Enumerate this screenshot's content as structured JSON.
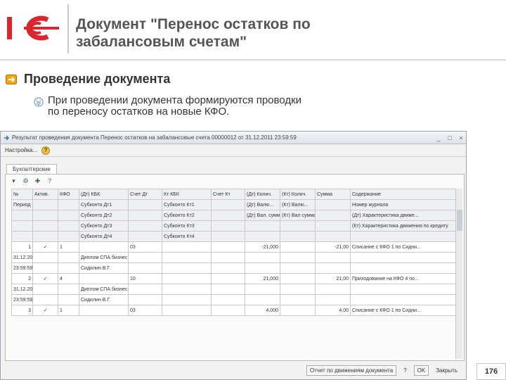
{
  "slide": {
    "title_line1": "Документ \"Перенос остатков по",
    "title_line2": "забалансовым счетам\"",
    "bullet1": "Проведение документа",
    "bullet2_line1": "При проведении документа формируются проводки",
    "bullet2_line2": "по переносу остатков на новые КФО.",
    "page_number": "176",
    "colors": {
      "logo_red": "#d7282f",
      "title_gray": "#555555"
    }
  },
  "window": {
    "title": "Результат проведения документа Перенос остатков на забалансовые счета 00000012 от 31.12.2011 23:59:59",
    "menu_label": "Настройка...",
    "tab_label": "Бухгалтерские",
    "header_rows": [
      [
        "№",
        "Актив.",
        "КФО",
        "(Дт) КБК",
        "Счет Дт",
        "Кт КБК",
        "Счет Кт",
        "(Дт) Колич.",
        "(Кт) Колич.",
        "Сумма",
        "Содержание"
      ],
      [
        "Период",
        "",
        "",
        "Субконто Дт1",
        "",
        "Субконто Кт1",
        "",
        "(Дт) Валю...",
        "(Кт) Валю...",
        "",
        "Номер журнала"
      ],
      [
        "",
        "",
        "",
        "Субконто Дт2",
        "",
        "Субконто Кт2",
        "",
        "(Дт) Вал. сумма",
        "(Кт) Вал сумма",
        "",
        "(Дт) Характеристика движе..."
      ],
      [
        "",
        "",
        "",
        "Субконто Дт3",
        "",
        "Субконто Кт3",
        "",
        "",
        "",
        "",
        "(Кт) Характеристика движения по кредиту"
      ],
      [
        "",
        "",
        "",
        "Субконто Дт4",
        "",
        "Субконто Кт4",
        "",
        "",
        "",
        "",
        ""
      ]
    ],
    "records": [
      {
        "num": "1",
        "check": "✓",
        "kfo": "1",
        "account_dt": "03",
        "qty_dt": "-21,000",
        "sum": "-21,00",
        "content": "Списание с КФО 1 по Сидни...",
        "period": [
          "31.12.2011",
          "23:59:59"
        ],
        "sub_dt": [
          "Диплом СПА бизнес школы",
          "Сидилин В.Г."
        ]
      },
      {
        "num": "2",
        "check": "✓",
        "kfo": "4",
        "account_dt": "10",
        "qty_dt": "21,000",
        "sum": "21,00",
        "content": "Приходование на КФО 4 по...",
        "period": [
          "31.12.2011",
          "23:59:59"
        ],
        "sub_dt": [
          "Диплом СПА бизнес школы",
          "Сидилин В.Г."
        ]
      },
      {
        "num": "3",
        "check": "✓",
        "kfo": "1",
        "account_dt": "03",
        "qty_dt": "4,000",
        "sum": "4,00",
        "content": "Списание с КФО 1 по Сидни...",
        "period": [],
        "sub_dt": []
      }
    ],
    "footer": {
      "report_button": "Отчет по движениям документа",
      "ok_button": "OK",
      "close_button": "Закрыть"
    }
  }
}
